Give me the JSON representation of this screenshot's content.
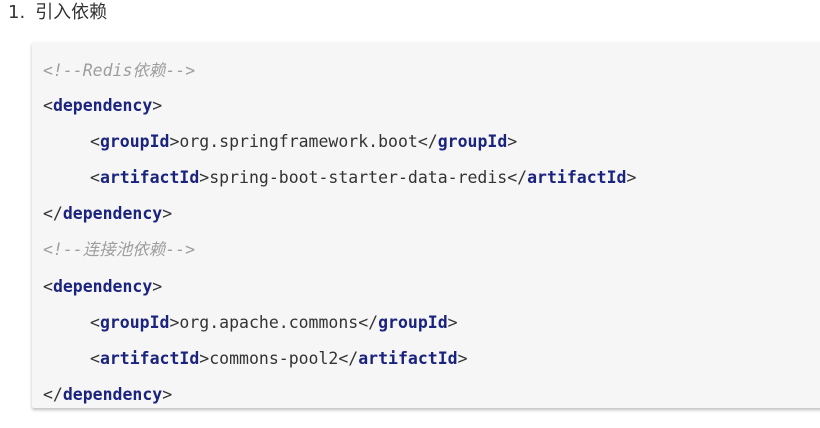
{
  "heading": {
    "number": "1.",
    "title": "引入依赖"
  },
  "code": {
    "comment_redis": "<!--Redis依赖-->",
    "dep1": {
      "open_tag": "dependency",
      "group_tag": "groupId",
      "group_value": "org.springframework.boot",
      "artifact_tag": "artifactId",
      "artifact_value": "spring-boot-starter-data-redis",
      "close_tag": "dependency"
    },
    "comment_pool": "<!--连接池依赖-->",
    "dep2": {
      "open_tag": "dependency",
      "group_tag": "groupId",
      "group_value": "org.apache.commons",
      "artifact_tag": "artifactId",
      "artifact_value": "commons-pool2",
      "close_tag": "dependency"
    }
  }
}
